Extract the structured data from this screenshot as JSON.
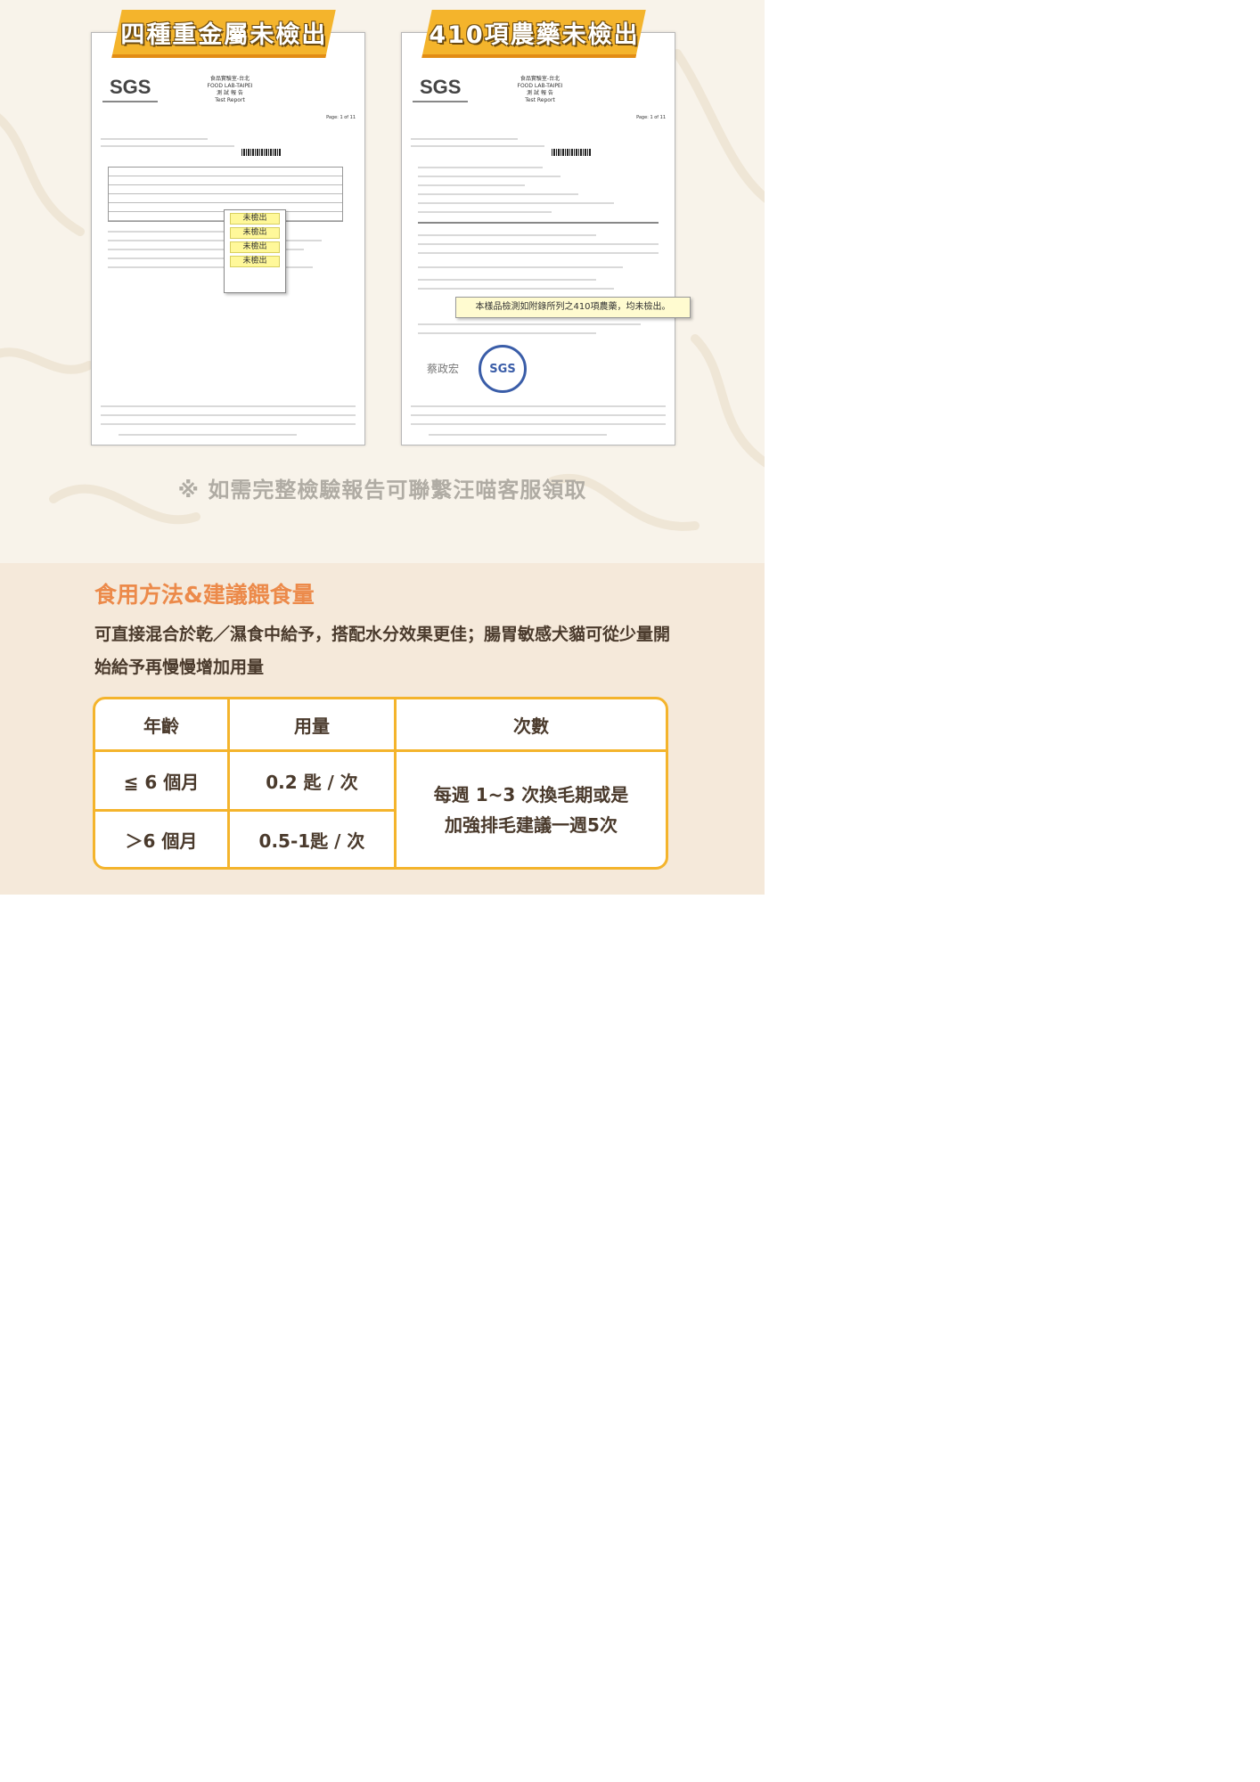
{
  "reports": [
    {
      "banner": "四種重金屬未檢出",
      "logo": "SGS",
      "lab_header": [
        "食品實驗室-台北",
        "FOOD LAB-TAIPEI",
        "測 試 報 告",
        "Test Report"
      ],
      "page": "Page: 1 of 11",
      "results": [
        "未檢出",
        "未檢出",
        "未檢出",
        "未檢出"
      ]
    },
    {
      "banner": "410項農藥未檢出",
      "logo": "SGS",
      "lab_header": [
        "食品實驗室-台北",
        "FOOD LAB-TAIPEI",
        "測 試 報 告",
        "Test Report"
      ],
      "page": "Page: 1 of 11",
      "callout": "本樣品檢測如附錄所列之410項農藥，均未檢出。",
      "signature": "蔡政宏",
      "seal": "SGS"
    }
  ],
  "contact_note": "※ 如需完整檢驗報告可聯繫汪喵客服領取",
  "feeding": {
    "title": "食用方法&建議餵食量",
    "description": "可直接混合於乾／濕食中給予，搭配水分效果更佳；腸胃敏感犬貓可從少量開始給予再慢慢增加用量",
    "headers": [
      "年齡",
      "用量",
      "次數"
    ],
    "rows": [
      {
        "age": "≦ 6 個月",
        "amount": "0.2 匙 / 次"
      },
      {
        "age": "＞6 個月",
        "amount": "0.5-1匙 / 次"
      }
    ],
    "frequency_line1": "每週 1~3 次換毛期或是",
    "frequency_line2": "加強排毛建議一週5次"
  },
  "colors": {
    "accent": "#f4b42c",
    "title": "#ec8a4a",
    "text": "#4a3a2c",
    "panel": "#f5e9da",
    "top_bg": "#f8f3ea"
  }
}
